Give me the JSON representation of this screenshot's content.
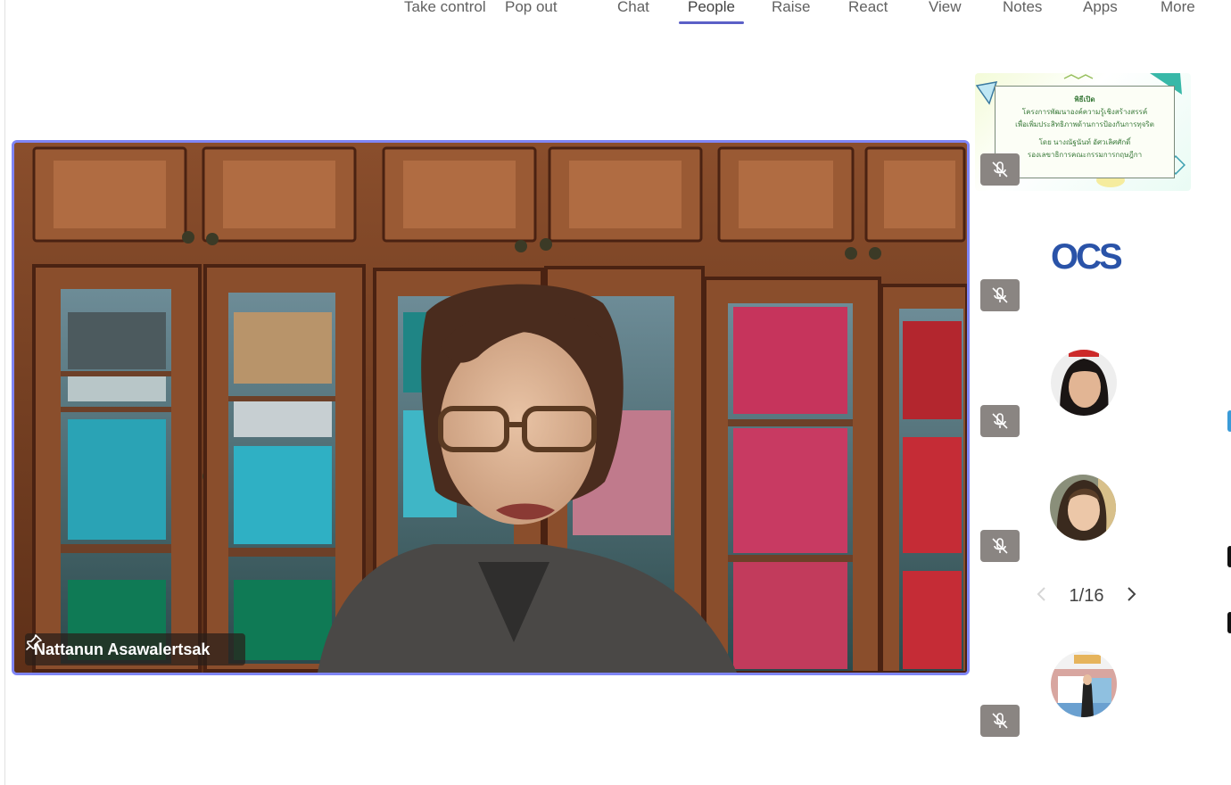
{
  "toolbar": {
    "items": [
      {
        "label": "Take control"
      },
      {
        "label": "Pop out"
      },
      {
        "label": "Chat"
      },
      {
        "label": "People"
      },
      {
        "label": "Raise"
      },
      {
        "label": "React"
      },
      {
        "label": "View"
      },
      {
        "label": "Notes"
      },
      {
        "label": "Apps"
      },
      {
        "label": "More"
      }
    ],
    "active": "People",
    "accent_color": "#5b5fc7"
  },
  "main_video": {
    "participant_name": "Nattanun Asawalertsak",
    "pinned": true,
    "border_color": "#7f85f5",
    "icon": "pin-icon"
  },
  "roster": {
    "tiles": [
      {
        "type": "slide",
        "muted": true,
        "slide_lines": [
          "พิธีเปิด",
          "โครงการพัฒนาองค์ความรู้เชิงสร้างสรรค์",
          "เพื่อเพิ่มประสิทธิภาพด้านการป้องกันการทุจริต",
          "โดย นางณัฐนันท์ อัศวเลิศศักดิ์",
          "รองเลขาธิการคณะกรรมการกฤษฎีกา"
        ]
      },
      {
        "type": "logo",
        "muted": true,
        "logo_text": "OCS"
      },
      {
        "type": "avatar",
        "muted": true
      },
      {
        "type": "avatar",
        "muted": true
      },
      {
        "type": "avatar",
        "muted": true
      }
    ],
    "pager": {
      "label": "1/16"
    },
    "icons": [
      "mic-off-icon",
      "chevron-left-icon",
      "chevron-right-icon"
    ]
  }
}
